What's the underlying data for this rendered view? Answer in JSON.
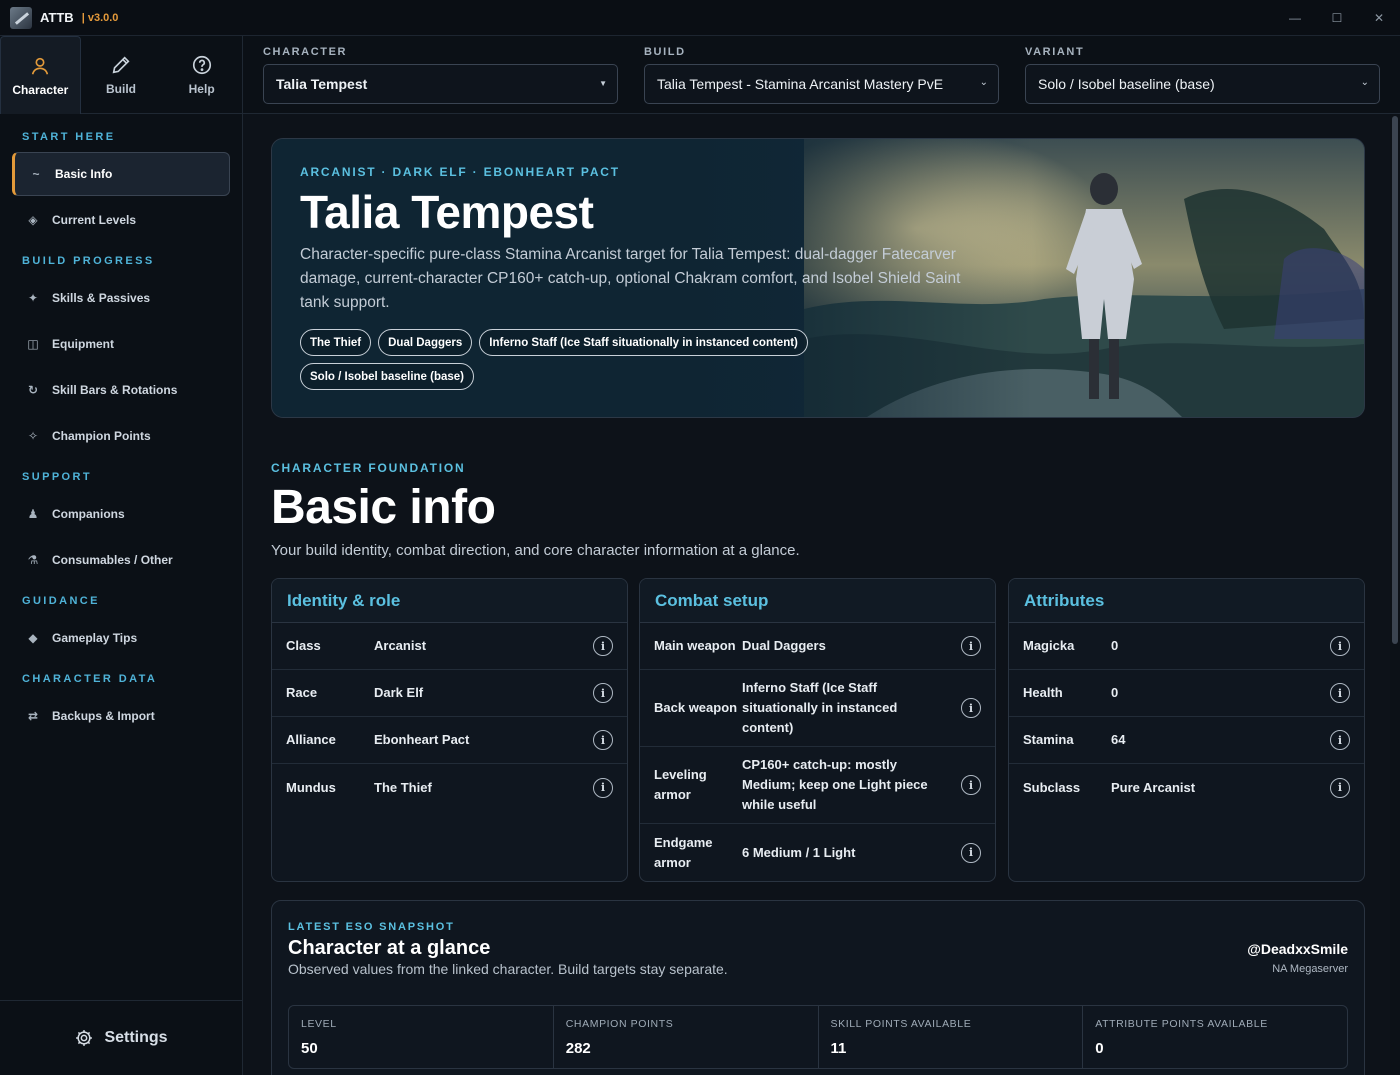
{
  "app": {
    "name": "ATTB",
    "version": "| v3.0.0"
  },
  "window_controls": {
    "minimize": "—",
    "maximize": "☐",
    "close": "✕"
  },
  "topnav": [
    {
      "label": "Character",
      "icon": "user-icon",
      "active": true
    },
    {
      "label": "Build",
      "icon": "pencil-icon",
      "active": false
    },
    {
      "label": "Help",
      "icon": "help-circle-icon",
      "active": false
    }
  ],
  "sidebar": {
    "sections": [
      {
        "heading": "START HERE",
        "items": [
          {
            "label": "Basic Info",
            "icon": "~",
            "active": true
          },
          {
            "label": "Current Levels",
            "icon": "◈"
          }
        ]
      },
      {
        "heading": "BUILD PROGRESS",
        "items": [
          {
            "label": "Skills & Passives",
            "icon": "✦"
          },
          {
            "label": "Equipment",
            "icon": "◫"
          },
          {
            "label": "Skill Bars & Rotations",
            "icon": "↻"
          },
          {
            "label": "Champion Points",
            "icon": "✧"
          }
        ]
      },
      {
        "heading": "SUPPORT",
        "items": [
          {
            "label": "Companions",
            "icon": "♟"
          },
          {
            "label": "Consumables / Other",
            "icon": "⚗"
          }
        ]
      },
      {
        "heading": "GUIDANCE",
        "items": [
          {
            "label": "Gameplay Tips",
            "icon": "◆"
          }
        ]
      },
      {
        "heading": "CHARACTER DATA",
        "items": [
          {
            "label": "Backups & Import",
            "icon": "⇄"
          }
        ]
      }
    ],
    "settings_label": "Settings"
  },
  "selectors": {
    "character": {
      "label": "CHARACTER",
      "value": "Talia Tempest"
    },
    "build": {
      "label": "BUILD",
      "value": "Talia Tempest - Stamina Arcanist Mastery PvE"
    },
    "variant": {
      "label": "VARIANT",
      "value": "Solo / Isobel baseline (base)"
    }
  },
  "hero": {
    "eyebrow": "ARCANIST · DARK ELF · EBONHEART PACT",
    "title": "Talia Tempest",
    "description": "Character-specific pure-class Stamina Arcanist target for Talia Tempest: dual-dagger Fatecarver damage, current-character CP160+ catch-up, optional Chakram comfort, and Isobel Shield Saint tank support.",
    "chips": [
      "The Thief",
      "Dual Daggers",
      "Inferno Staff (Ice Staff situationally in instanced content)",
      "Solo / Isobel baseline (base)"
    ]
  },
  "section": {
    "eyebrow": "CHARACTER FOUNDATION",
    "title": "Basic info",
    "subtitle": "Your build identity, combat direction, and core character information at a glance."
  },
  "cards": {
    "identity": {
      "title": "Identity & role",
      "rows": [
        {
          "key": "Class",
          "value": "Arcanist"
        },
        {
          "key": "Race",
          "value": "Dark Elf"
        },
        {
          "key": "Alliance",
          "value": "Ebonheart Pact"
        },
        {
          "key": "Mundus",
          "value": "The Thief"
        }
      ]
    },
    "combat": {
      "title": "Combat setup",
      "rows": [
        {
          "key": "Main weapon",
          "value": "Dual Daggers"
        },
        {
          "key": "Back weapon",
          "value": "Inferno Staff (Ice Staff situationally in instanced content)"
        },
        {
          "key": "Leveling armor",
          "value": "CP160+ catch-up: mostly Medium; keep one Light piece while useful"
        },
        {
          "key": "Endgame armor",
          "value": "6 Medium / 1 Light"
        }
      ]
    },
    "attributes": {
      "title": "Attributes",
      "rows": [
        {
          "key": "Magicka",
          "value": "0"
        },
        {
          "key": "Health",
          "value": "0"
        },
        {
          "key": "Stamina",
          "value": "64"
        },
        {
          "key": "Subclass",
          "value": "Pure Arcanist"
        }
      ]
    }
  },
  "snapshot": {
    "eyebrow": "LATEST ESO SNAPSHOT",
    "title": "Character at a glance",
    "subtitle": "Observed values from the linked character. Build targets stay separate.",
    "account": "@DeadxxSmile",
    "server": "NA Megaserver",
    "stats": [
      {
        "label": "LEVEL",
        "value": "50"
      },
      {
        "label": "CHAMPION POINTS",
        "value": "282"
      },
      {
        "label": "SKILL POINTS AVAILABLE",
        "value": "11"
      },
      {
        "label": "ATTRIBUTE POINTS AVAILABLE",
        "value": "0"
      }
    ]
  },
  "colors": {
    "accent": "#5bc0e0",
    "active_marker": "#e39a3a",
    "background": "#0d1219"
  }
}
